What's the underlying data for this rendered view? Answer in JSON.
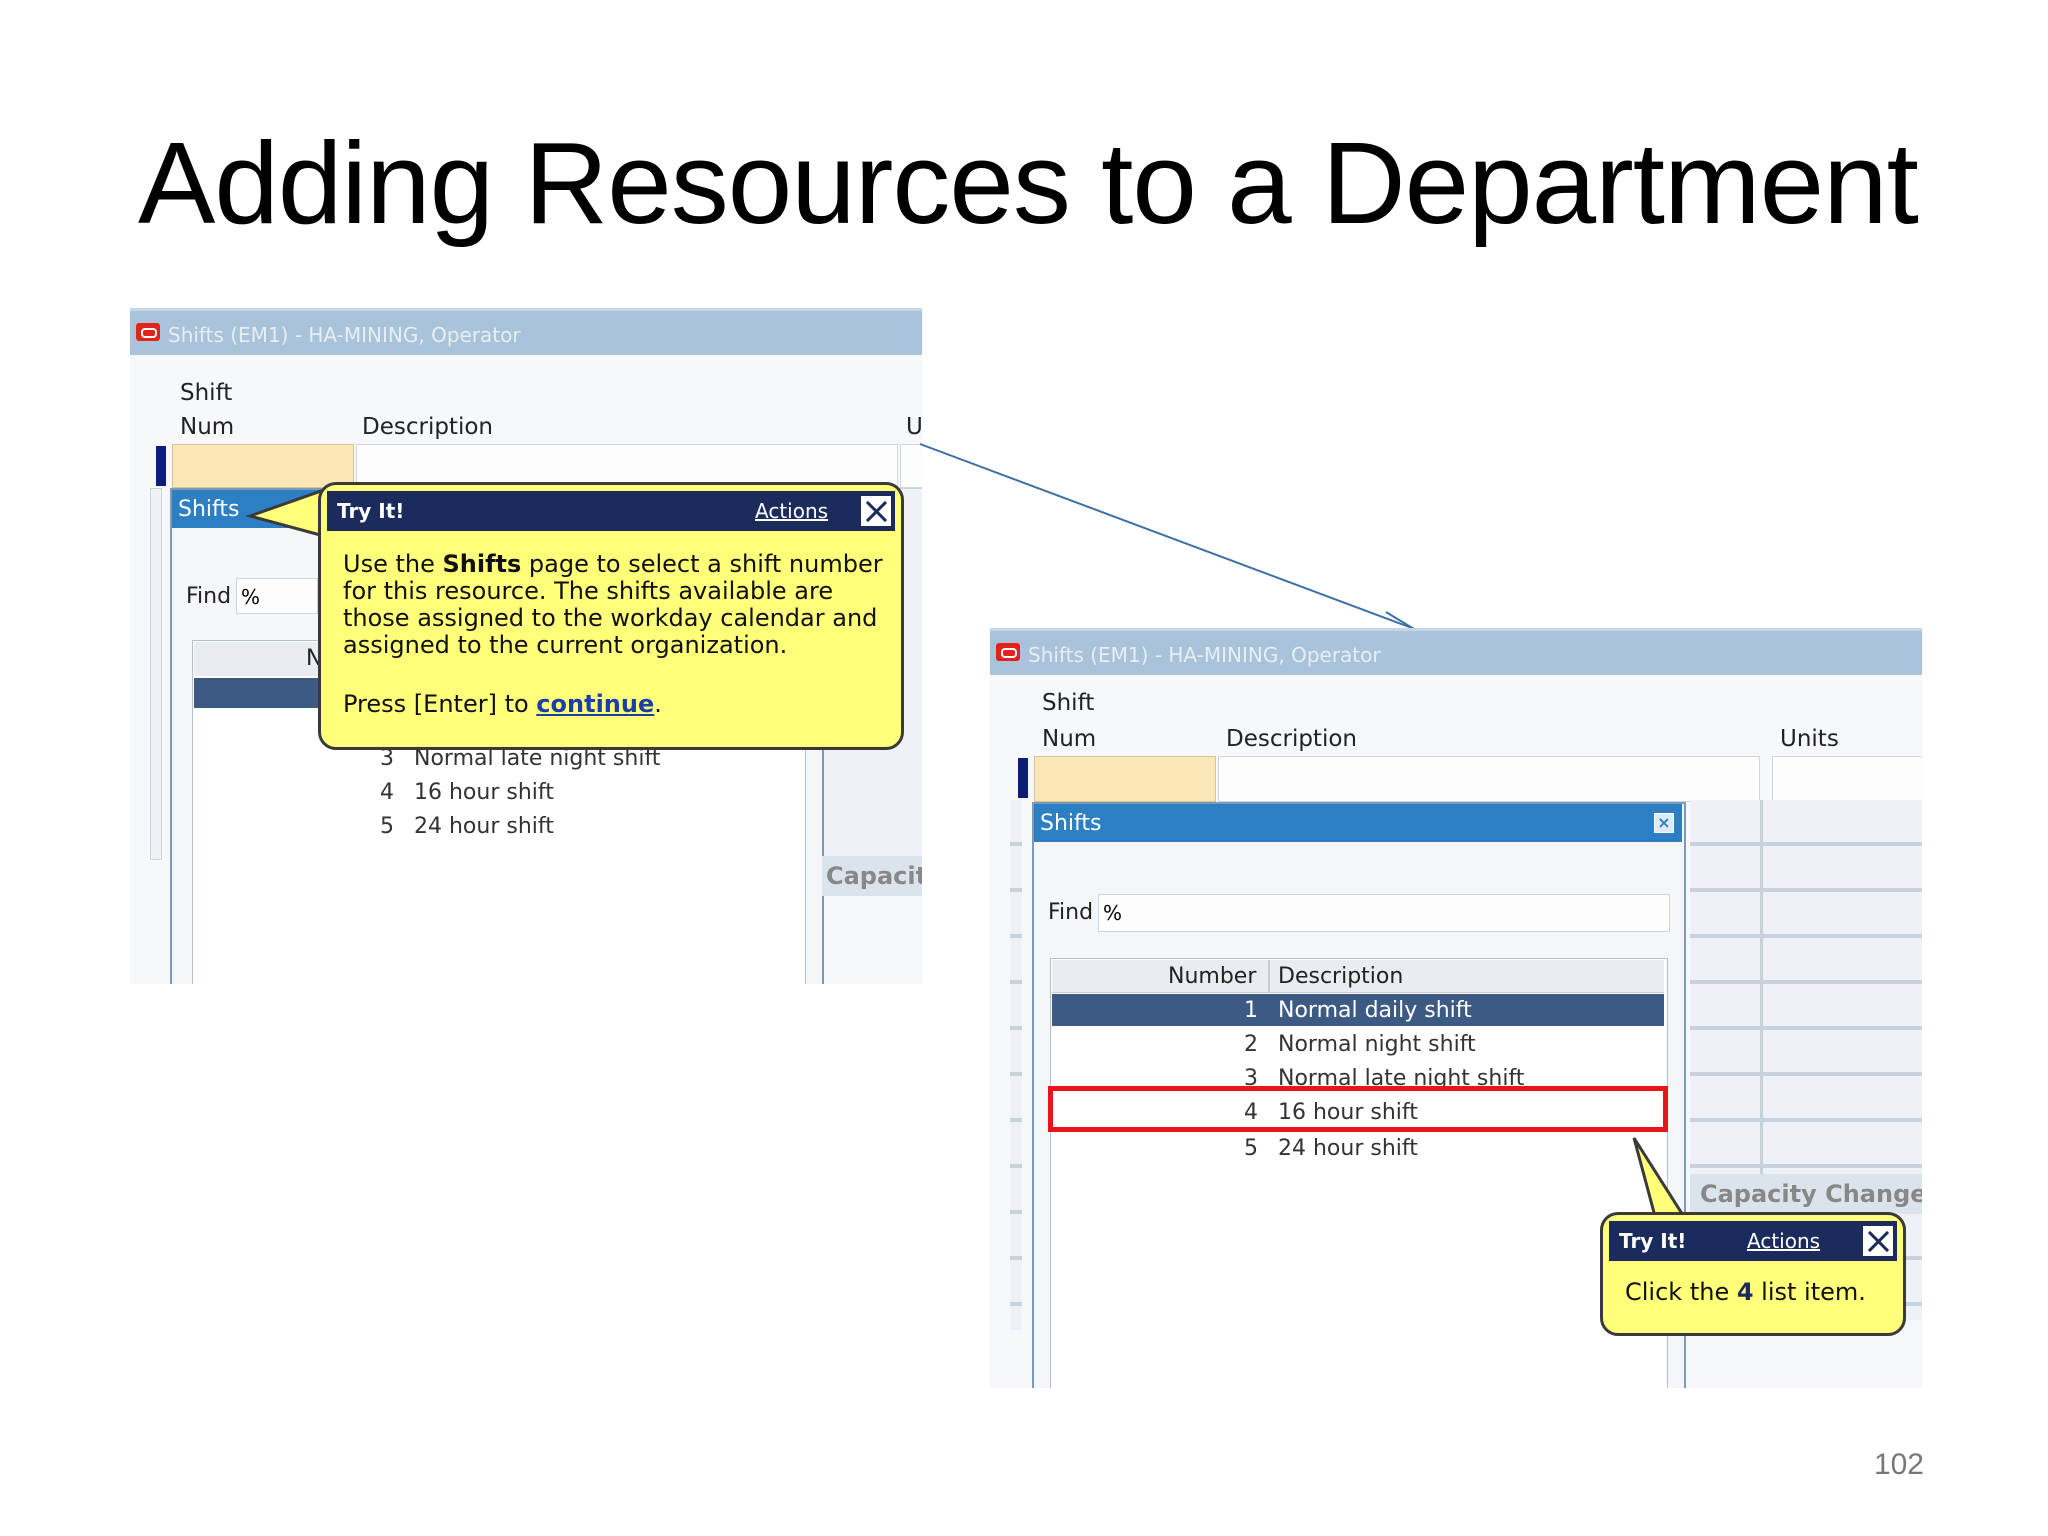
{
  "slide": {
    "title": "Adding Resources to a Department",
    "page_number": "102"
  },
  "left_screen": {
    "window_title": "Shifts (EM1) - HA-MINING, Operator",
    "col_shift": "Shift",
    "col_num": "Num",
    "col_description": "Description",
    "col_units_partial": "U",
    "subwindow_title": "Shifts",
    "find_label": "Find",
    "find_value": "%",
    "list_header_partial": "N",
    "rows": [
      {
        "num": "3",
        "desc": "Normal late night shift"
      },
      {
        "num": "4",
        "desc": "16 hour shift"
      },
      {
        "num": "5",
        "desc": "24 hour shift"
      }
    ],
    "capacity_partial": "Capacit",
    "balloon": {
      "tryit": "Try It!",
      "actions": "Actions",
      "text_pre": "Use the ",
      "text_bold": "Shifts",
      "text_post": " page to select a shift number for this resource. The shifts available are those assigned to the workday calendar and assigned to the current organization.",
      "press_pre": "Press [Enter] to ",
      "press_link": "continue",
      "press_post": "."
    }
  },
  "right_screen": {
    "window_title": "Shifts (EM1) - HA-MINING, Operator",
    "col_shift": "Shift",
    "col_num": "Num",
    "col_description": "Description",
    "col_units": "Units",
    "subwindow_title": "Shifts",
    "find_label": "Find",
    "find_value": "%",
    "list_headers": {
      "number": "Number",
      "description": "Description"
    },
    "rows": [
      {
        "num": "1",
        "desc": "Normal daily shift"
      },
      {
        "num": "2",
        "desc": "Normal night shift"
      },
      {
        "num": "3",
        "desc": "Normal late night shift"
      },
      {
        "num": "4",
        "desc": "16 hour shift"
      },
      {
        "num": "5",
        "desc": "24 hour shift"
      }
    ],
    "capacity_changes": "Capacity Changes",
    "balloon": {
      "tryit": "Try It!",
      "actions": "Actions",
      "text_pre": "Click the ",
      "text_bold": "4",
      "text_post": " list item."
    }
  },
  "colors": {
    "highlight": "#e8151b",
    "balloon": "#ffff7a",
    "titlebar": "#a9c3da",
    "connector": "#3d6fa8"
  }
}
